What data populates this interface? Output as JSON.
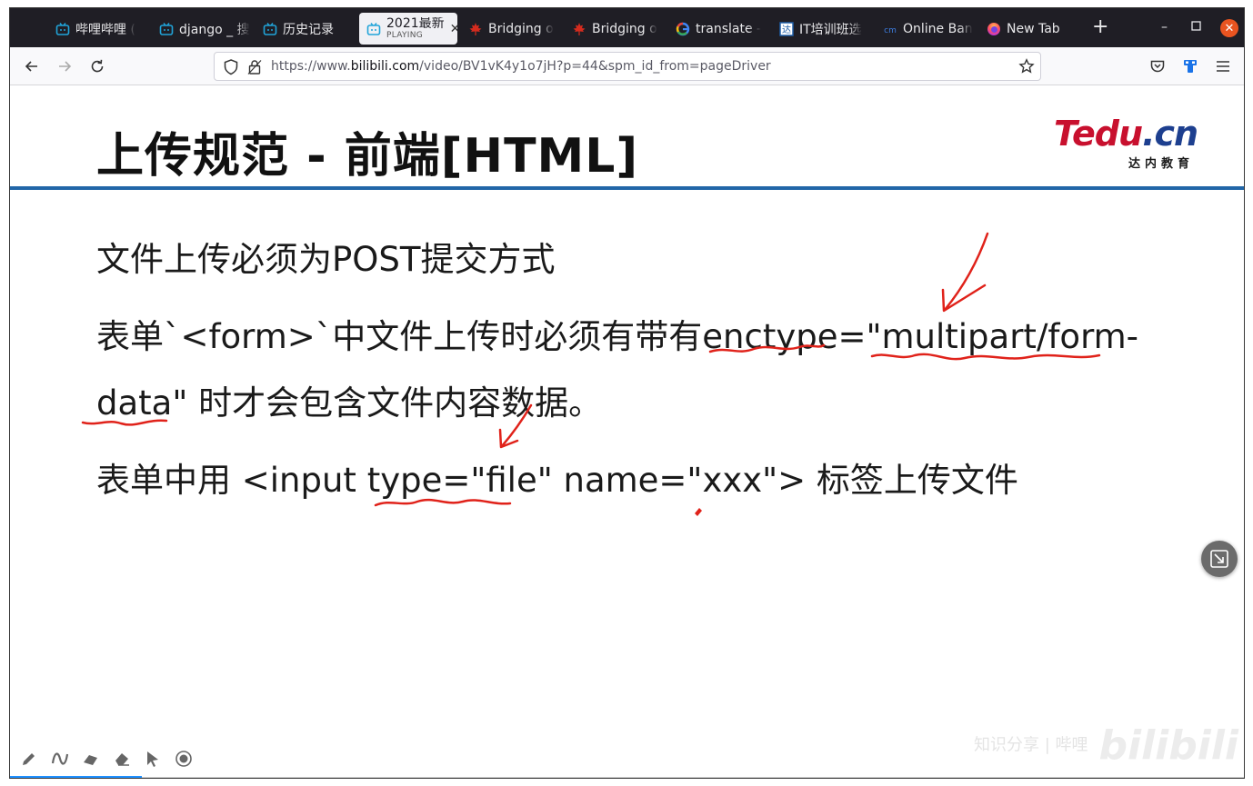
{
  "browser": {
    "tabs": [
      {
        "label": "哔哩哔哩 (",
        "icon": "bilibili-tv-icon"
      },
      {
        "label": "django _ 搜",
        "icon": "bilibili-tv-icon"
      },
      {
        "label": "历史记录",
        "icon": "bilibili-tv-icon"
      },
      {
        "label": "2021最新",
        "sublabel": "PLAYING",
        "icon": "bilibili-tv-icon",
        "active": true
      },
      {
        "label": "Bridging o",
        "icon": "maple-leaf-icon"
      },
      {
        "label": "Bridging o",
        "icon": "maple-leaf-icon"
      },
      {
        "label": "translate -",
        "icon": "google-icon"
      },
      {
        "label": "IT培训班选",
        "icon": "site-icon"
      },
      {
        "label": "Online Ban",
        "icon": "csdn-icon"
      },
      {
        "label": "New Tab",
        "icon": "firefox-icon"
      }
    ],
    "url_prefix": "https://www.",
    "url_host": "bilibili.com",
    "url_path": "/video/BV1vK4y1o7jH?p=44&spm_id_from=pageDriver"
  },
  "slide": {
    "title": "上传规范 - 前端[HTML]",
    "logo_main": "Tedu",
    "logo_dot": ".cn",
    "logo_sub": "达内教育",
    "lines": [
      "文件上传必须为POST提交方式",
      "表单`<form>`中文件上传时必须有带有enctype=\"multipart/form-",
      "data\" 时才会包含文件内容数据。",
      "表单中用 <input type=\"file\" name=\"xxx\"> 标签上传文件"
    ]
  },
  "watermark": {
    "text": "知识分享 | 哔哩",
    "brand": "bilibili"
  },
  "colors": {
    "accent_rule": "#2166a8",
    "ink": "#e0221a",
    "logo_red": "#c8102e",
    "logo_blue": "#1d3f8f",
    "progress": "#1e90ff"
  }
}
